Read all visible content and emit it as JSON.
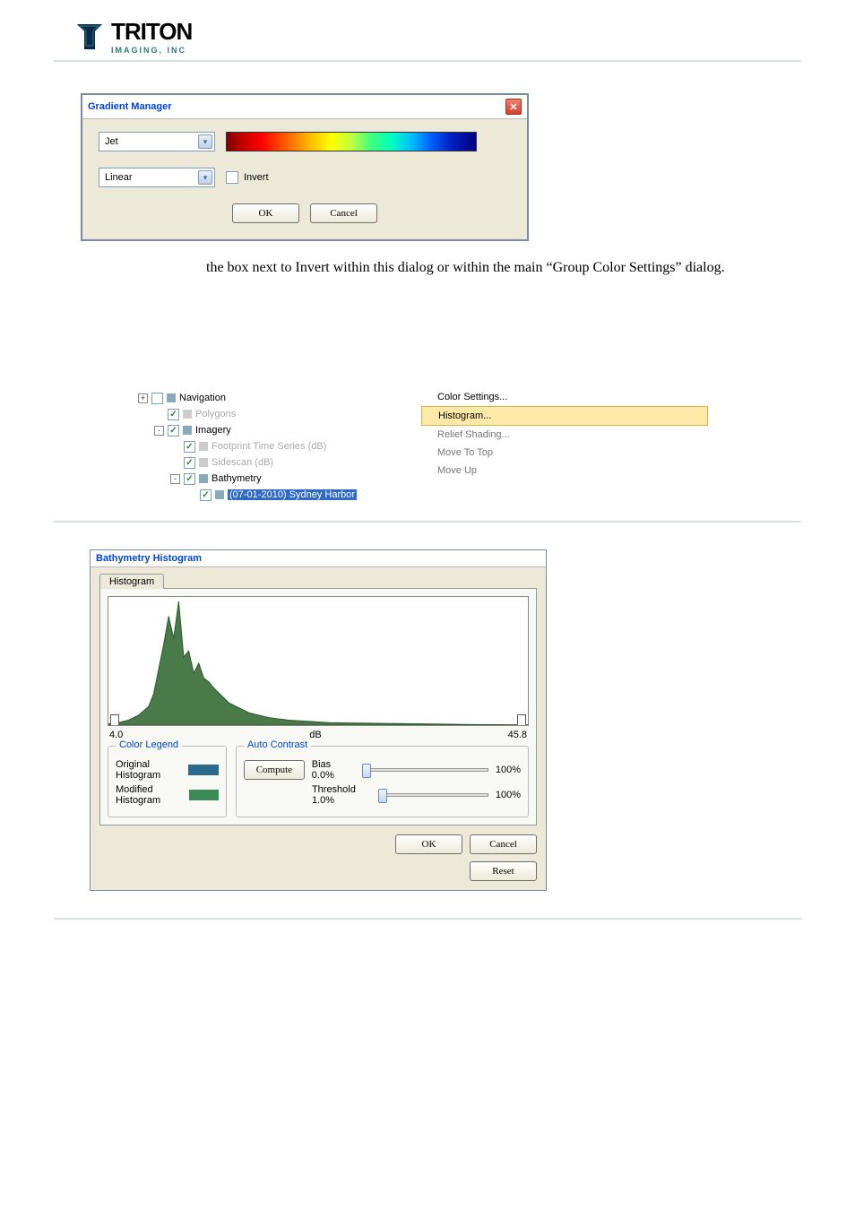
{
  "logo": {
    "name": "TRITON",
    "sub": "IMAGING, INC"
  },
  "gradient_dialog": {
    "title": "Gradient Manager",
    "colormap": "Jet",
    "interp": "Linear",
    "invert_label": "Invert",
    "ok": "OK",
    "cancel": "Cancel"
  },
  "body_paragraph": "the box next to Invert within this dialog or within the main “Group Color Settings” dialog.",
  "tree": {
    "items": [
      {
        "label": "Navigation",
        "indent": 0,
        "checked": false,
        "gray": false,
        "exp": "+"
      },
      {
        "label": "Polygons",
        "indent": 1,
        "checked": true,
        "gray": true
      },
      {
        "label": "Imagery",
        "indent": 1,
        "checked": true,
        "gray": false,
        "exp": "-"
      },
      {
        "label": "Footprint Time Series (dB)",
        "indent": 2,
        "checked": true,
        "gray": true
      },
      {
        "label": "Sidescan (dB)",
        "indent": 2,
        "checked": true,
        "gray": true
      },
      {
        "label": "Bathymetry",
        "indent": 2,
        "checked": true,
        "gray": false,
        "exp": "-"
      },
      {
        "label": "(07-01-2010) Sydney Harbor",
        "indent": 3,
        "checked": true,
        "gray": false,
        "selected": true
      }
    ]
  },
  "context_menu": {
    "items": [
      {
        "label": "Color Settings...",
        "enabled": true
      },
      {
        "label": "Histogram...",
        "enabled": true,
        "hilite": true
      },
      {
        "label": "Relief Shading...",
        "enabled": false
      },
      {
        "label": "Move To Top",
        "enabled": false
      },
      {
        "label": "Move Up",
        "enabled": false
      }
    ]
  },
  "histo_dialog": {
    "title": "Bathymetry Histogram",
    "tab": "Histogram",
    "axis_label": "dB",
    "axis_min": "4.0",
    "axis_max": "45.8",
    "legend_title": "Color Legend",
    "orig_label": "Original Histogram",
    "mod_label": "Modified Histogram",
    "auto_title": "Auto Contrast",
    "compute": "Compute",
    "bias_label": "Bias 0.0%",
    "thresh_label": "Threshold 1.0%",
    "bias_pct": "100%",
    "thresh_pct": "100%",
    "ok": "OK",
    "cancel": "Cancel",
    "reset": "Reset"
  },
  "chart_data": {
    "type": "area",
    "title": "Bathymetry Histogram",
    "xlabel": "dB",
    "ylabel": "",
    "xlim": [
      4.0,
      45.8
    ],
    "x": [
      4.0,
      5.0,
      6.0,
      7.0,
      8.0,
      8.5,
      9.0,
      9.5,
      10.0,
      10.5,
      11.0,
      11.5,
      12.0,
      12.5,
      13.0,
      13.5,
      14.0,
      14.5,
      15.0,
      15.5,
      16.0,
      17.0,
      18.0,
      19.0,
      20.0,
      22.0,
      24.0,
      26.0,
      30.0,
      35.0,
      40.0,
      45.8
    ],
    "values": [
      1,
      2,
      4,
      8,
      15,
      25,
      45,
      65,
      88,
      70,
      100,
      55,
      60,
      42,
      50,
      38,
      35,
      30,
      26,
      22,
      18,
      14,
      10,
      8,
      6,
      4,
      3,
      2,
      1.5,
      1,
      0.5,
      0.2
    ]
  }
}
